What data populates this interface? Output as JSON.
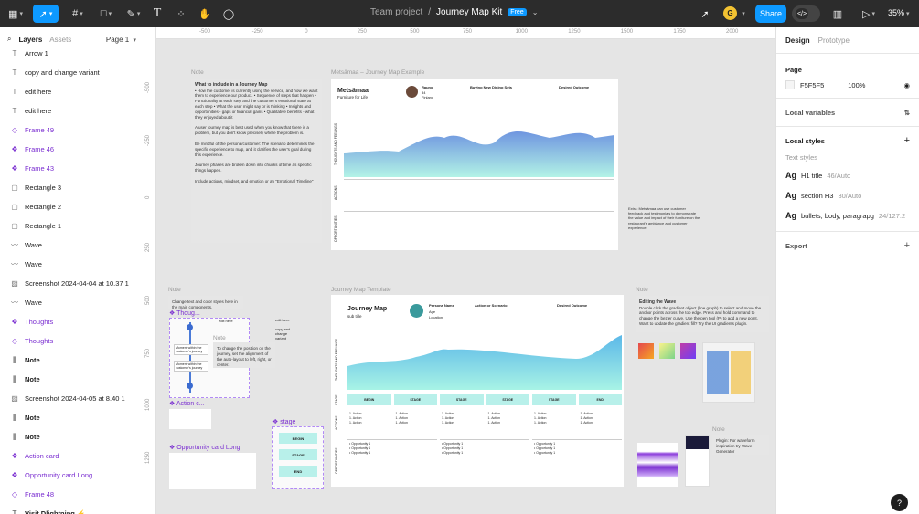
{
  "topbar": {
    "project": "Team project",
    "separator": "/",
    "file": "Journey Map Kit",
    "plan_badge": "Free",
    "share_label": "Share",
    "avatar_initial": "G",
    "zoom": "35%",
    "colors": {
      "bg": "#2c2c2c",
      "accent": "#0d99ff"
    }
  },
  "left": {
    "tab_layers": "Layers",
    "tab_assets": "Assets",
    "page": "Page 1",
    "layers": [
      {
        "label": "Arrow 1",
        "icon": "text-icon",
        "kind": "normal"
      },
      {
        "label": "copy and change variant",
        "icon": "text-icon",
        "kind": "normal"
      },
      {
        "label": "edit here",
        "icon": "text-icon",
        "kind": "normal"
      },
      {
        "label": "edit here",
        "icon": "text-icon",
        "kind": "normal"
      },
      {
        "label": "Frame 49",
        "icon": "instance-icon",
        "kind": "purple"
      },
      {
        "label": "Frame 46",
        "icon": "component-icon",
        "kind": "purple"
      },
      {
        "label": "Frame 43",
        "icon": "component-icon",
        "kind": "purple"
      },
      {
        "label": "Rectangle 3",
        "icon": "rectangle-icon",
        "kind": "normal"
      },
      {
        "label": "Rectangle 2",
        "icon": "rectangle-icon",
        "kind": "normal"
      },
      {
        "label": "Rectangle 1",
        "icon": "rectangle-icon",
        "kind": "normal"
      },
      {
        "label": "Wave",
        "icon": "vector-icon",
        "kind": "normal"
      },
      {
        "label": "Wave",
        "icon": "vector-icon",
        "kind": "normal"
      },
      {
        "label": "Screenshot 2024-04-04 at 10.37 1",
        "icon": "image-icon",
        "kind": "normal"
      },
      {
        "label": "Wave",
        "icon": "vector-icon",
        "kind": "normal"
      },
      {
        "label": "Thoughts",
        "icon": "component-icon",
        "kind": "purple"
      },
      {
        "label": "Thoughts",
        "icon": "instance-icon",
        "kind": "purple"
      },
      {
        "label": "Note",
        "icon": "section-icon",
        "kind": "bold"
      },
      {
        "label": "Note",
        "icon": "section-icon",
        "kind": "bold"
      },
      {
        "label": "Screenshot 2024-04-05 at 8.40 1",
        "icon": "image-icon",
        "kind": "normal"
      },
      {
        "label": "Note",
        "icon": "section-icon",
        "kind": "bold"
      },
      {
        "label": "Note",
        "icon": "section-icon",
        "kind": "bold"
      },
      {
        "label": "Action card",
        "icon": "component-icon",
        "kind": "purple"
      },
      {
        "label": "Opportunity card Long",
        "icon": "component-icon",
        "kind": "purple"
      },
      {
        "label": "Frame 48",
        "icon": "instance-icon",
        "kind": "purple"
      },
      {
        "label": "Visit Dlightning ⚡",
        "icon": "text-icon",
        "kind": "bold"
      }
    ]
  },
  "canvas": {
    "ruler_x": [
      "-500",
      "-250",
      "0",
      "250",
      "500",
      "750",
      "1000",
      "1250",
      "1500",
      "1750",
      "2000"
    ],
    "ruler_y": [
      "-500",
      "-250",
      "0",
      "250",
      "500",
      "750",
      "1000",
      "1250"
    ],
    "frames": {
      "note1": "Note",
      "example": "Metsämaa – Journey Map Example",
      "note2": "Note",
      "template": "Journey Map Template",
      "note3": "Note",
      "note4": "Note",
      "thoughts": "Thoug...",
      "action": "Action c...",
      "opportunity": "Opportunity card Long",
      "stage": "stage"
    },
    "note_texts": {
      "what_title": "What to include in a Journey Map",
      "what_body": "• How the customer is currently using the service, and how we want them to experience our product. • Sequence of steps that happen • Functionality at each step and the customer's emotional state at each step • What the user might say or is thinking • Insights and opportunities - gaps or financial gains • Qualitative benefits - what they enjoyed about it",
      "what_body2": "A user journey map is best used when you know that there is a problem, but you don't know precisely where the problem is.",
      "what_body3": "Be mindful of the persona/customer: The scenario determines the specific experience to map, and it clarifies the user's goal during this experience.",
      "what_body4": "Journey phases are broken down into chunks of time as specific things happen.",
      "what_body5": "Include actions, mindset, and emotion or an \"Emotional Timeline\"",
      "change_text": "Change text and color styles here in the main components.",
      "wave_title": "Editing the Wave",
      "wave_body": "Double click the gradient object (line graph) to select and move the anchor points across the top edge. Press and hold command to change the bezier curve. Use the pen tool (P) to add a new point.",
      "wave_body2": "Want to update the gradient fill? Try the UI gradients plugin.",
      "extra": "Extra: Metsämaa can use customer feedback and testimonials to demonstrate the value and impact of their furniture on the restaurant's ambiance and customer experience.",
      "plugin": "Plugin: For waveform inspiration try Wave Generator",
      "edit_here": "edit here",
      "copy_change": "copy and change variant",
      "moment": "Moment within the customer's journey",
      "drag_note": "To change the position on the journey, set the alignment of the auto-layout to left, right, or center."
    },
    "example_text": {
      "brand": "Metsämaa",
      "brand_sub": "Furniture for Life",
      "persona": "Rauno",
      "age": "34",
      "loc": "Finland",
      "scenario_h": "Buying New Dining Sets",
      "outcome_h": "Desired Outcome",
      "row_thoughts": "THOUGHTS AND FEELINGS",
      "row_actions": "ACTIONS",
      "row_opps": "OPPORTUNITIES"
    },
    "template_text": {
      "title": "Journey Map",
      "subtitle": "sub title",
      "persona_h": "Persona Name",
      "persona_age": "Age",
      "persona_loc": "Location",
      "scenario_h": "Action or Scenario",
      "outcome_h": "Desired Outcome",
      "stages": [
        "BEGIN",
        "STAGE",
        "STAGE",
        "STAGE",
        "STAGE",
        "END"
      ],
      "action": "1. Action",
      "opp": "• Opportunity 1",
      "row_thoughts": "THOUGHTS AND FEELINGS",
      "row_stage": "STAGE",
      "row_actions": "ACTIONS",
      "row_opps": "OPPORTUNITIES"
    },
    "stage_buttons": [
      "BEGIN",
      "STAGE",
      "END"
    ]
  },
  "right": {
    "tab_design": "Design",
    "tab_prototype": "Prototype",
    "page_h": "Page",
    "page_color": "F5F5F5",
    "page_opacity": "100%",
    "local_vars": "Local variables",
    "local_styles": "Local styles",
    "text_styles": "Text styles",
    "styles": [
      {
        "ag": "Ag",
        "name": "H1 title",
        "size": "46/Auto"
      },
      {
        "ag": "Ag",
        "name": "section H3",
        "size": "30/Auto"
      },
      {
        "ag": "Ag",
        "name": "bullets, body, paragrapg",
        "size": "24/127.2"
      }
    ],
    "export": "Export",
    "help": "?"
  }
}
